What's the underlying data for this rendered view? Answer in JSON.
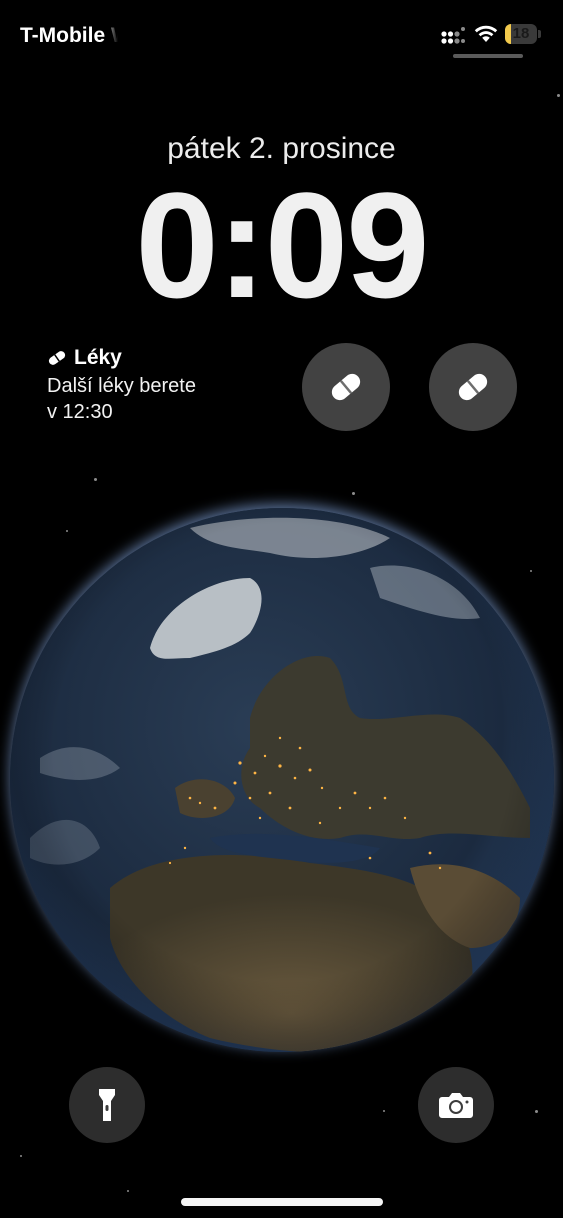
{
  "status_bar": {
    "carrier": "T-Mobile W",
    "battery_level": "18",
    "battery_fraction": 0.18,
    "signal_icon": "cellular-signal-icon",
    "wifi_icon": "wifi-icon"
  },
  "lock_screen": {
    "date": "pátek 2. prosince",
    "time": "0:09"
  },
  "widgets": {
    "meds": {
      "icon": "pill-icon",
      "title": "Léky",
      "line1": "Další léky berete",
      "line2": "v 12:30"
    },
    "circle_1": {
      "icon": "pill-icon"
    },
    "circle_2": {
      "icon": "pill-icon"
    }
  },
  "wallpaper": {
    "subject": "earth-globe",
    "colors": {
      "ocean": "#1d2f45",
      "land": "#4a4130",
      "ice": "#c9ced3",
      "atmosphere": "#7fb0ff",
      "city_lights": "#ffb545"
    }
  },
  "quick_actions": {
    "left": {
      "icon": "flashlight-icon"
    },
    "right": {
      "icon": "camera-icon"
    }
  }
}
